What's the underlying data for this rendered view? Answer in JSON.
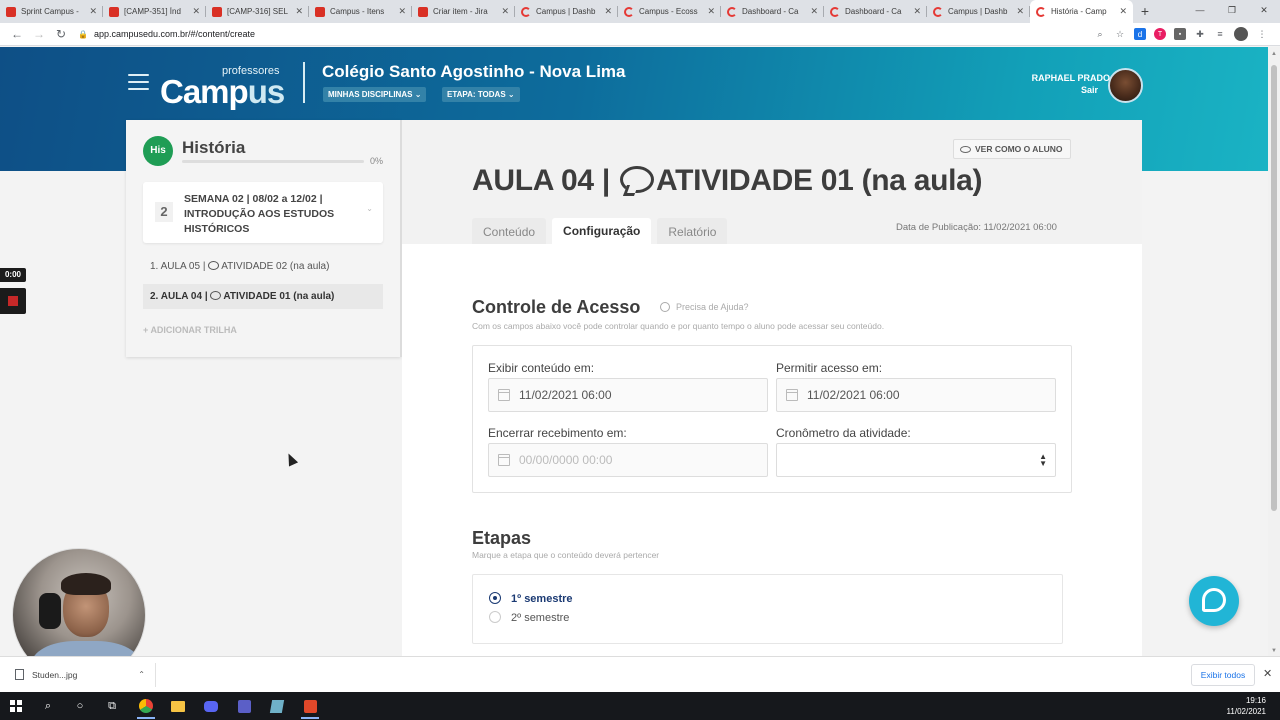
{
  "browser": {
    "tabs": [
      {
        "title": "Sprint Campus -",
        "icon": "red"
      },
      {
        "title": "[CAMP-351] Índ",
        "icon": "red"
      },
      {
        "title": "[CAMP-316] SEL",
        "icon": "red"
      },
      {
        "title": "Campus - Itens",
        "icon": "red"
      },
      {
        "title": "Criar item - Jira",
        "icon": "red"
      },
      {
        "title": "Campus | Dashb",
        "icon": "ring"
      },
      {
        "title": "Campus - Ecoss",
        "icon": "ring"
      },
      {
        "title": "Dashboard - Ca",
        "icon": "ring"
      },
      {
        "title": "Dashboard - Ca",
        "icon": "ring"
      },
      {
        "title": "Campus | Dashb",
        "icon": "ring"
      },
      {
        "title": "História - Camp",
        "icon": "ring",
        "active": true
      }
    ],
    "url": "app.campusedu.com.br/#/content/create",
    "colors": {
      "tab_active": "#ffffff",
      "tabstrip": "#dee1e6"
    }
  },
  "header": {
    "logo_prefix": "Camp",
    "logo_suffix": "us",
    "logo_top": "professores",
    "school": "Colégio Santo Agostinho - Nova Lima",
    "disciplinas_label": "MINHAS DISCIPLINAS",
    "etapa_label": "ETAPA: TODAS",
    "user_name": "RAPHAEL PRADO",
    "logout_label": "Sair",
    "gradient_colors": [
      "#0e4f86",
      "#1ab3c4"
    ]
  },
  "sidebar": {
    "subject_badge": "His",
    "subject_name": "História",
    "progress_label": "0%",
    "progress_value": 0,
    "week_number": "2",
    "week_title": "SEMANA 02 | 08/02 a 12/02 | INTRODUÇÃO AOS ESTUDOS HISTÓRICOS",
    "lessons": [
      {
        "prefix": "1. AULA 05 |",
        "suffix": "ATIVIDADE 02 (na aula)",
        "active": false
      },
      {
        "prefix": "2. AULA 04 |",
        "suffix": "ATIVIDADE 01 (na aula)",
        "active": true
      }
    ],
    "add_track_label": "ADICIONAR TRILHA"
  },
  "main": {
    "view_as_student": "VER COMO O ALUNO",
    "title_prefix": "AULA 04 |",
    "title_suffix": "ATIVIDADE 01 (na aula)",
    "tabs": [
      "Conteúdo",
      "Configuração",
      "Relatório"
    ],
    "active_tab": "Configuração",
    "publish_date": "Data de Publicação: 11/02/2021 06:00",
    "access": {
      "title": "Controle de Acesso",
      "help_label": "Precisa de Ajuda?",
      "subtitle": "Com os campos abaixo você pode controlar quando e por quanto tempo o aluno pode acessar seu conteúdo.",
      "show_label": "Exibir conteúdo em:",
      "show_value": "11/02/2021 06:00",
      "allow_label": "Permitir acesso em:",
      "allow_value": "11/02/2021 06:00",
      "close_label": "Encerrar recebimento em:",
      "close_placeholder": "00/00/0000 00:00",
      "timer_label": "Cronômetro da atividade:",
      "timer_value": ""
    },
    "stages": {
      "title": "Etapas",
      "subtitle": "Marque a etapa que o conteúdo deverá pertencer",
      "options": [
        {
          "label": "1º semestre",
          "selected": true
        },
        {
          "label": "2º semestre",
          "selected": false
        }
      ]
    }
  },
  "recorder": {
    "time": "0:00"
  },
  "downloads": {
    "file_name": "Studen...jpg",
    "show_all": "Exibir todos"
  },
  "taskbar": {
    "time": "19:16",
    "date": "11/02/2021",
    "icons": [
      "windows-start",
      "search",
      "cortana",
      "task-view",
      "chrome",
      "file-explorer",
      "discord",
      "teams",
      "notes",
      "app"
    ]
  }
}
